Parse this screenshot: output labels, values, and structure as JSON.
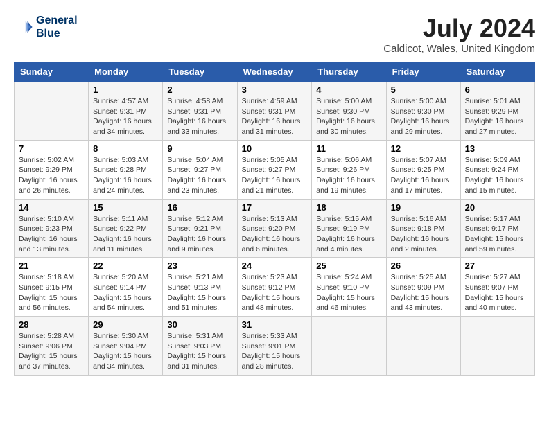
{
  "header": {
    "logo_line1": "General",
    "logo_line2": "Blue",
    "month_year": "July 2024",
    "location": "Caldicot, Wales, United Kingdom"
  },
  "days_of_week": [
    "Sunday",
    "Monday",
    "Tuesday",
    "Wednesday",
    "Thursday",
    "Friday",
    "Saturday"
  ],
  "weeks": [
    [
      {
        "day": "",
        "info": ""
      },
      {
        "day": "1",
        "info": "Sunrise: 4:57 AM\nSunset: 9:31 PM\nDaylight: 16 hours\nand 34 minutes."
      },
      {
        "day": "2",
        "info": "Sunrise: 4:58 AM\nSunset: 9:31 PM\nDaylight: 16 hours\nand 33 minutes."
      },
      {
        "day": "3",
        "info": "Sunrise: 4:59 AM\nSunset: 9:31 PM\nDaylight: 16 hours\nand 31 minutes."
      },
      {
        "day": "4",
        "info": "Sunrise: 5:00 AM\nSunset: 9:30 PM\nDaylight: 16 hours\nand 30 minutes."
      },
      {
        "day": "5",
        "info": "Sunrise: 5:00 AM\nSunset: 9:30 PM\nDaylight: 16 hours\nand 29 minutes."
      },
      {
        "day": "6",
        "info": "Sunrise: 5:01 AM\nSunset: 9:29 PM\nDaylight: 16 hours\nand 27 minutes."
      }
    ],
    [
      {
        "day": "7",
        "info": "Sunrise: 5:02 AM\nSunset: 9:29 PM\nDaylight: 16 hours\nand 26 minutes."
      },
      {
        "day": "8",
        "info": "Sunrise: 5:03 AM\nSunset: 9:28 PM\nDaylight: 16 hours\nand 24 minutes."
      },
      {
        "day": "9",
        "info": "Sunrise: 5:04 AM\nSunset: 9:27 PM\nDaylight: 16 hours\nand 23 minutes."
      },
      {
        "day": "10",
        "info": "Sunrise: 5:05 AM\nSunset: 9:27 PM\nDaylight: 16 hours\nand 21 minutes."
      },
      {
        "day": "11",
        "info": "Sunrise: 5:06 AM\nSunset: 9:26 PM\nDaylight: 16 hours\nand 19 minutes."
      },
      {
        "day": "12",
        "info": "Sunrise: 5:07 AM\nSunset: 9:25 PM\nDaylight: 16 hours\nand 17 minutes."
      },
      {
        "day": "13",
        "info": "Sunrise: 5:09 AM\nSunset: 9:24 PM\nDaylight: 16 hours\nand 15 minutes."
      }
    ],
    [
      {
        "day": "14",
        "info": "Sunrise: 5:10 AM\nSunset: 9:23 PM\nDaylight: 16 hours\nand 13 minutes."
      },
      {
        "day": "15",
        "info": "Sunrise: 5:11 AM\nSunset: 9:22 PM\nDaylight: 16 hours\nand 11 minutes."
      },
      {
        "day": "16",
        "info": "Sunrise: 5:12 AM\nSunset: 9:21 PM\nDaylight: 16 hours\nand 9 minutes."
      },
      {
        "day": "17",
        "info": "Sunrise: 5:13 AM\nSunset: 9:20 PM\nDaylight: 16 hours\nand 6 minutes."
      },
      {
        "day": "18",
        "info": "Sunrise: 5:15 AM\nSunset: 9:19 PM\nDaylight: 16 hours\nand 4 minutes."
      },
      {
        "day": "19",
        "info": "Sunrise: 5:16 AM\nSunset: 9:18 PM\nDaylight: 16 hours\nand 2 minutes."
      },
      {
        "day": "20",
        "info": "Sunrise: 5:17 AM\nSunset: 9:17 PM\nDaylight: 15 hours\nand 59 minutes."
      }
    ],
    [
      {
        "day": "21",
        "info": "Sunrise: 5:18 AM\nSunset: 9:15 PM\nDaylight: 15 hours\nand 56 minutes."
      },
      {
        "day": "22",
        "info": "Sunrise: 5:20 AM\nSunset: 9:14 PM\nDaylight: 15 hours\nand 54 minutes."
      },
      {
        "day": "23",
        "info": "Sunrise: 5:21 AM\nSunset: 9:13 PM\nDaylight: 15 hours\nand 51 minutes."
      },
      {
        "day": "24",
        "info": "Sunrise: 5:23 AM\nSunset: 9:12 PM\nDaylight: 15 hours\nand 48 minutes."
      },
      {
        "day": "25",
        "info": "Sunrise: 5:24 AM\nSunset: 9:10 PM\nDaylight: 15 hours\nand 46 minutes."
      },
      {
        "day": "26",
        "info": "Sunrise: 5:25 AM\nSunset: 9:09 PM\nDaylight: 15 hours\nand 43 minutes."
      },
      {
        "day": "27",
        "info": "Sunrise: 5:27 AM\nSunset: 9:07 PM\nDaylight: 15 hours\nand 40 minutes."
      }
    ],
    [
      {
        "day": "28",
        "info": "Sunrise: 5:28 AM\nSunset: 9:06 PM\nDaylight: 15 hours\nand 37 minutes."
      },
      {
        "day": "29",
        "info": "Sunrise: 5:30 AM\nSunset: 9:04 PM\nDaylight: 15 hours\nand 34 minutes."
      },
      {
        "day": "30",
        "info": "Sunrise: 5:31 AM\nSunset: 9:03 PM\nDaylight: 15 hours\nand 31 minutes."
      },
      {
        "day": "31",
        "info": "Sunrise: 5:33 AM\nSunset: 9:01 PM\nDaylight: 15 hours\nand 28 minutes."
      },
      {
        "day": "",
        "info": ""
      },
      {
        "day": "",
        "info": ""
      },
      {
        "day": "",
        "info": ""
      }
    ]
  ]
}
